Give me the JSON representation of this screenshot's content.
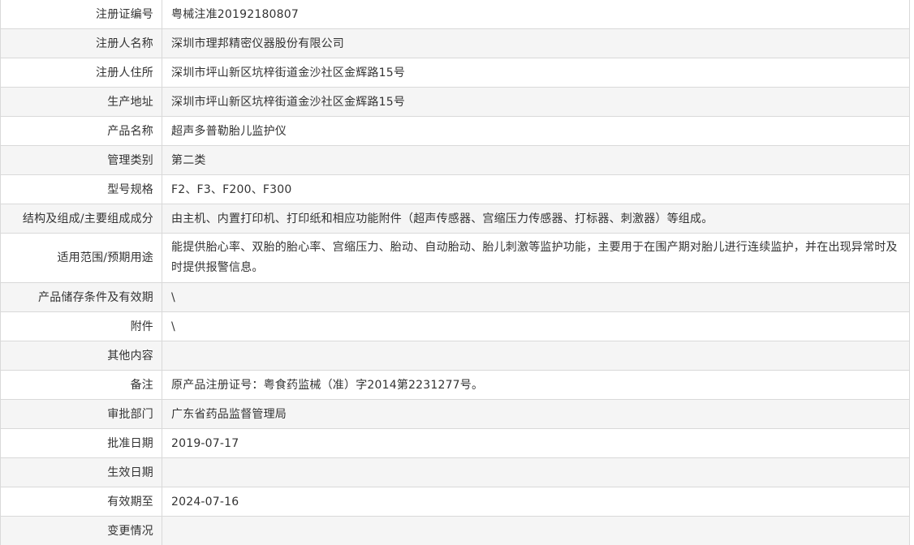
{
  "rows": [
    {
      "label": "注册证编号",
      "value": "粤械注准20192180807"
    },
    {
      "label": "注册人名称",
      "value": "深圳市理邦精密仪器股份有限公司"
    },
    {
      "label": "注册人住所",
      "value": "深圳市坪山新区坑梓街道金沙社区金辉路15号"
    },
    {
      "label": "生产地址",
      "value": "深圳市坪山新区坑梓街道金沙社区金辉路15号"
    },
    {
      "label": "产品名称",
      "value": "超声多普勒胎儿监护仪"
    },
    {
      "label": "管理类别",
      "value": "第二类"
    },
    {
      "label": "型号规格",
      "value": "F2、F3、F200、F300"
    },
    {
      "label": "结构及组成/主要组成成分",
      "value": "由主机、内置打印机、打印纸和相应功能附件（超声传感器、宫缩压力传感器、打标器、刺激器）等组成。"
    },
    {
      "label": "适用范围/预期用途",
      "value": "能提供胎心率、双胎的胎心率、宫缩压力、胎动、自动胎动、胎儿刺激等监护功能，主要用于在围产期对胎儿进行连续监护，并在出现异常时及时提供报警信息。"
    },
    {
      "label": "产品储存条件及有效期",
      "value": "\\"
    },
    {
      "label": "附件",
      "value": "\\"
    },
    {
      "label": "其他内容",
      "value": ""
    },
    {
      "label": "备注",
      "value": "原产品注册证号：粤食药监械（准）字2014第2231277号。"
    },
    {
      "label": "审批部门",
      "value": "广东省药品监督管理局"
    },
    {
      "label": "批准日期",
      "value": "2019-07-17"
    },
    {
      "label": "生效日期",
      "value": ""
    },
    {
      "label": "有效期至",
      "value": "2024-07-16"
    },
    {
      "label": "变更情况",
      "value": ""
    }
  ]
}
